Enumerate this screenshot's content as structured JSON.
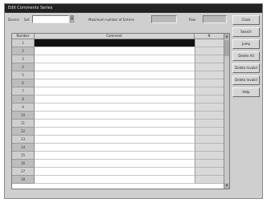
{
  "window": {
    "title": "Edit Comments Series"
  },
  "top": {
    "device_label": "Device",
    "set_label": "Set",
    "set_value": "",
    "max_label": "Maximum number of Entries",
    "max_value": "",
    "row_label": "Row",
    "row_value": ""
  },
  "grid": {
    "columns": [
      "Number",
      "Comment",
      "N"
    ],
    "rows": [
      {
        "num": "1",
        "value": "",
        "extra": "",
        "selected": true
      },
      {
        "num": "2",
        "value": "",
        "extra": ""
      },
      {
        "num": "3",
        "value": "",
        "extra": ""
      },
      {
        "num": "4",
        "value": "",
        "extra": ""
      },
      {
        "num": "5",
        "value": "",
        "extra": ""
      },
      {
        "num": "6",
        "value": "",
        "extra": ""
      },
      {
        "num": "7",
        "value": "",
        "extra": ""
      },
      {
        "num": "8",
        "value": "",
        "extra": ""
      },
      {
        "num": "9",
        "value": "",
        "extra": ""
      },
      {
        "num": "10",
        "value": "",
        "extra": ""
      },
      {
        "num": "11",
        "value": "",
        "extra": ""
      },
      {
        "num": "12",
        "value": "",
        "extra": ""
      },
      {
        "num": "13",
        "value": "",
        "extra": ""
      },
      {
        "num": "14",
        "value": "",
        "extra": ""
      },
      {
        "num": "15",
        "value": "",
        "extra": ""
      },
      {
        "num": "16",
        "value": "",
        "extra": ""
      },
      {
        "num": "17",
        "value": "",
        "extra": ""
      },
      {
        "num": "18",
        "value": "",
        "extra": ""
      }
    ]
  },
  "buttons": [
    "Close",
    "Search",
    "Jump",
    "Delete All",
    "Delete Invalid",
    "Delete Invalid",
    "Help"
  ],
  "colors": {
    "titlebar": "#222222",
    "selection": "#111111",
    "window": "#cfcfcf"
  }
}
